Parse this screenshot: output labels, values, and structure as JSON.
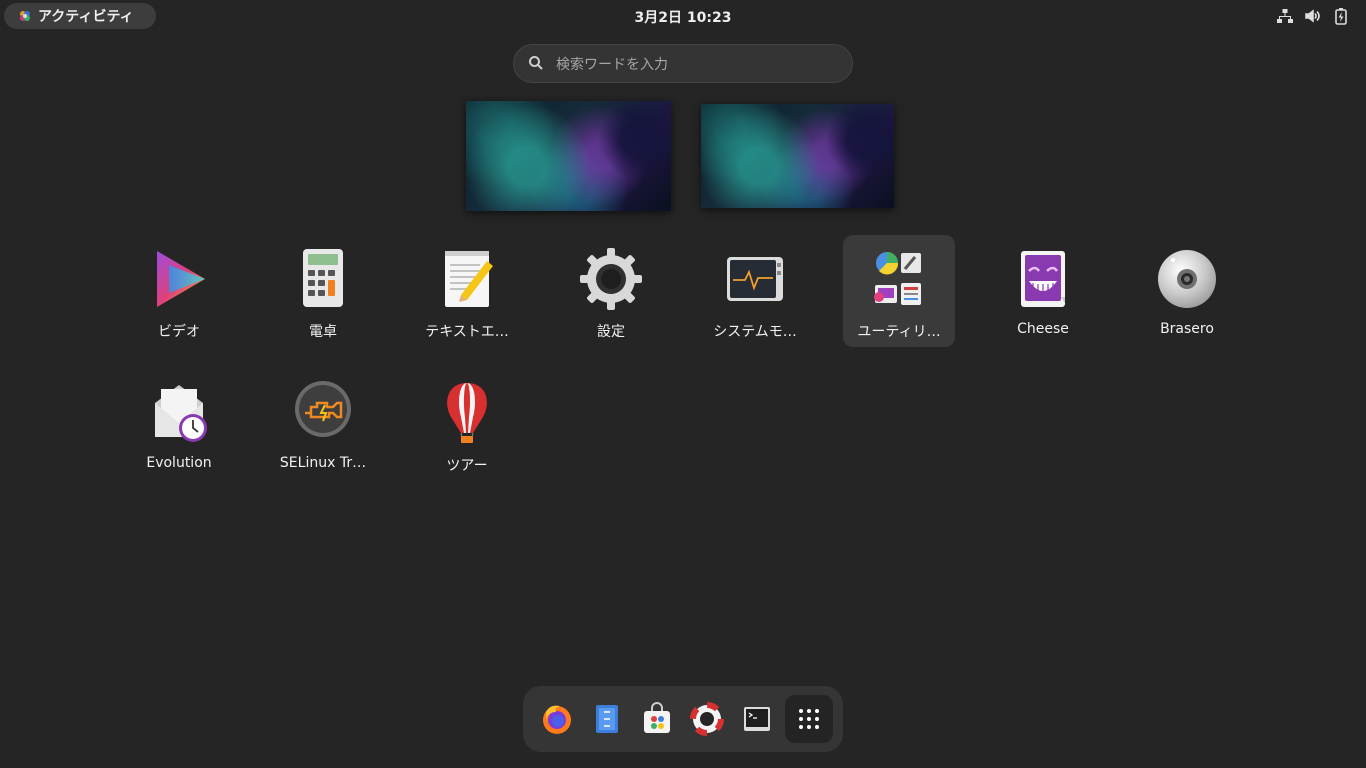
{
  "topbar": {
    "activities_label": "アクティビティ",
    "clock": "3月2日  10:23"
  },
  "search": {
    "placeholder": "検索ワードを入力"
  },
  "apps": [
    {
      "label": "ビデオ",
      "icon": "video-icon"
    },
    {
      "label": "電卓",
      "icon": "calculator-icon"
    },
    {
      "label": "テキストエ…",
      "icon": "text-editor-icon"
    },
    {
      "label": "設定",
      "icon": "settings-gear-icon"
    },
    {
      "label": "システムモ…",
      "icon": "system-monitor-icon"
    },
    {
      "label": "ユーティリ…",
      "icon": "utilities-folder-icon"
    },
    {
      "label": "Cheese",
      "icon": "cheese-icon"
    },
    {
      "label": "Brasero",
      "icon": "brasero-disc-icon"
    },
    {
      "label": "Evolution",
      "icon": "evolution-mail-icon"
    },
    {
      "label": "SELinux Tr…",
      "icon": "selinux-troubleshooter-icon"
    },
    {
      "label": "ツアー",
      "icon": "tour-balloon-icon"
    }
  ],
  "dash": [
    "firefox-icon",
    "files-icon",
    "software-icon",
    "help-icon",
    "terminal-icon",
    "show-apps-grid-icon"
  ],
  "colors": {
    "background": "#252525",
    "highlight": "#3a3a3a",
    "dash": "#353535"
  }
}
